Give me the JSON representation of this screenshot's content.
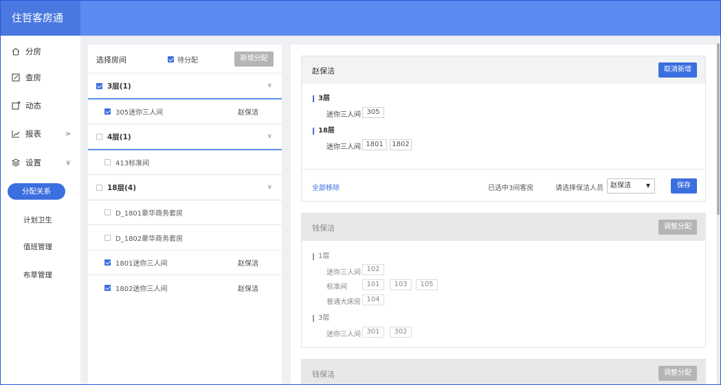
{
  "app": {
    "title": "住哲客房通"
  },
  "sidebar": {
    "items": [
      {
        "label": "分房",
        "icon": "home-icon"
      },
      {
        "label": "查房",
        "icon": "edit-icon"
      },
      {
        "label": "动态",
        "icon": "message-icon"
      },
      {
        "label": "报表",
        "icon": "chart-icon",
        "arrow": ">"
      },
      {
        "label": "设置",
        "icon": "layers-icon",
        "arrow": "∨"
      }
    ],
    "subitems": [
      {
        "label": "分配关系",
        "active": true
      },
      {
        "label": "计划卫生",
        "active": false
      },
      {
        "label": "值班管理",
        "active": false
      },
      {
        "label": "布草管理",
        "active": false
      }
    ]
  },
  "room_panel": {
    "title": "选择房间",
    "pending_label": "待分配",
    "pending_checked": true,
    "add_button": "新增分配",
    "rows": [
      {
        "kind": "floor",
        "label": "3层(1)",
        "checked": true
      },
      {
        "kind": "room",
        "label": "305迷你三人间",
        "checked": true,
        "assignee": "赵保洁"
      },
      {
        "kind": "floor",
        "label": "4层(1)",
        "checked": false
      },
      {
        "kind": "room",
        "label": "413标准间",
        "checked": false,
        "assignee": ""
      },
      {
        "kind": "floor",
        "label": "18层(4)",
        "checked": false
      },
      {
        "kind": "room",
        "label": "D_1801豪华商务套房",
        "checked": false,
        "assignee": ""
      },
      {
        "kind": "room",
        "label": "D_1802豪华商务套房",
        "checked": false,
        "assignee": ""
      },
      {
        "kind": "room",
        "label": "1801迷你三人间",
        "checked": true,
        "assignee": "赵保洁"
      },
      {
        "kind": "room",
        "label": "1802迷你三人间",
        "checked": true,
        "assignee": "赵保洁"
      }
    ]
  },
  "cards": [
    {
      "name": "赵保洁",
      "button": "取消新增",
      "floors": [
        {
          "label": "3层",
          "types": [
            {
              "label": "迷你三人间",
              "rooms": [
                "305"
              ]
            }
          ]
        },
        {
          "label": "18层",
          "types": [
            {
              "label": "迷你三人间",
              "rooms": [
                "1801",
                "1802"
              ]
            }
          ]
        }
      ],
      "footer": {
        "remove_all": "全部移除",
        "selected_text": "已选中3间客房",
        "select_label": "请选择保洁人员",
        "select_value": "赵保洁",
        "save": "保存"
      }
    },
    {
      "name": "钱保洁",
      "button": "调整分配",
      "floors": [
        {
          "label": "1层",
          "types": [
            {
              "label": "迷你三人间",
              "rooms": [
                "102"
              ]
            },
            {
              "label": "标准间",
              "rooms": [
                "101",
                "103",
                "105"
              ]
            },
            {
              "label": "普通大床房",
              "rooms": [
                "104"
              ]
            }
          ]
        },
        {
          "label": "3层",
          "types": [
            {
              "label": "迷你三人间",
              "rooms": [
                "301",
                "302"
              ]
            }
          ]
        }
      ]
    },
    {
      "name": "钱保洁",
      "button": "调整分配"
    }
  ],
  "colors": {
    "header": "#5b8bf0",
    "logo_bg": "#4a78e0",
    "accent": "#3b6fe0",
    "disabled": "#b5b5b5"
  }
}
